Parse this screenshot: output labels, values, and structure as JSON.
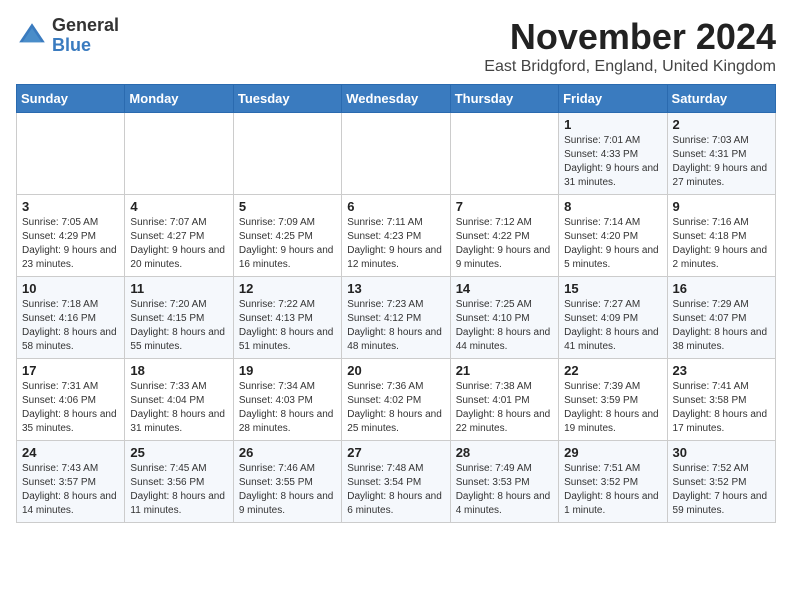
{
  "header": {
    "logo_general": "General",
    "logo_blue": "Blue",
    "month_title": "November 2024",
    "location": "East Bridgford, England, United Kingdom"
  },
  "days_of_week": [
    "Sunday",
    "Monday",
    "Tuesday",
    "Wednesday",
    "Thursday",
    "Friday",
    "Saturday"
  ],
  "weeks": [
    [
      {
        "day": "",
        "info": ""
      },
      {
        "day": "",
        "info": ""
      },
      {
        "day": "",
        "info": ""
      },
      {
        "day": "",
        "info": ""
      },
      {
        "day": "",
        "info": ""
      },
      {
        "day": "1",
        "info": "Sunrise: 7:01 AM\nSunset: 4:33 PM\nDaylight: 9 hours and 31 minutes."
      },
      {
        "day": "2",
        "info": "Sunrise: 7:03 AM\nSunset: 4:31 PM\nDaylight: 9 hours and 27 minutes."
      }
    ],
    [
      {
        "day": "3",
        "info": "Sunrise: 7:05 AM\nSunset: 4:29 PM\nDaylight: 9 hours and 23 minutes."
      },
      {
        "day": "4",
        "info": "Sunrise: 7:07 AM\nSunset: 4:27 PM\nDaylight: 9 hours and 20 minutes."
      },
      {
        "day": "5",
        "info": "Sunrise: 7:09 AM\nSunset: 4:25 PM\nDaylight: 9 hours and 16 minutes."
      },
      {
        "day": "6",
        "info": "Sunrise: 7:11 AM\nSunset: 4:23 PM\nDaylight: 9 hours and 12 minutes."
      },
      {
        "day": "7",
        "info": "Sunrise: 7:12 AM\nSunset: 4:22 PM\nDaylight: 9 hours and 9 minutes."
      },
      {
        "day": "8",
        "info": "Sunrise: 7:14 AM\nSunset: 4:20 PM\nDaylight: 9 hours and 5 minutes."
      },
      {
        "day": "9",
        "info": "Sunrise: 7:16 AM\nSunset: 4:18 PM\nDaylight: 9 hours and 2 minutes."
      }
    ],
    [
      {
        "day": "10",
        "info": "Sunrise: 7:18 AM\nSunset: 4:16 PM\nDaylight: 8 hours and 58 minutes."
      },
      {
        "day": "11",
        "info": "Sunrise: 7:20 AM\nSunset: 4:15 PM\nDaylight: 8 hours and 55 minutes."
      },
      {
        "day": "12",
        "info": "Sunrise: 7:22 AM\nSunset: 4:13 PM\nDaylight: 8 hours and 51 minutes."
      },
      {
        "day": "13",
        "info": "Sunrise: 7:23 AM\nSunset: 4:12 PM\nDaylight: 8 hours and 48 minutes."
      },
      {
        "day": "14",
        "info": "Sunrise: 7:25 AM\nSunset: 4:10 PM\nDaylight: 8 hours and 44 minutes."
      },
      {
        "day": "15",
        "info": "Sunrise: 7:27 AM\nSunset: 4:09 PM\nDaylight: 8 hours and 41 minutes."
      },
      {
        "day": "16",
        "info": "Sunrise: 7:29 AM\nSunset: 4:07 PM\nDaylight: 8 hours and 38 minutes."
      }
    ],
    [
      {
        "day": "17",
        "info": "Sunrise: 7:31 AM\nSunset: 4:06 PM\nDaylight: 8 hours and 35 minutes."
      },
      {
        "day": "18",
        "info": "Sunrise: 7:33 AM\nSunset: 4:04 PM\nDaylight: 8 hours and 31 minutes."
      },
      {
        "day": "19",
        "info": "Sunrise: 7:34 AM\nSunset: 4:03 PM\nDaylight: 8 hours and 28 minutes."
      },
      {
        "day": "20",
        "info": "Sunrise: 7:36 AM\nSunset: 4:02 PM\nDaylight: 8 hours and 25 minutes."
      },
      {
        "day": "21",
        "info": "Sunrise: 7:38 AM\nSunset: 4:01 PM\nDaylight: 8 hours and 22 minutes."
      },
      {
        "day": "22",
        "info": "Sunrise: 7:39 AM\nSunset: 3:59 PM\nDaylight: 8 hours and 19 minutes."
      },
      {
        "day": "23",
        "info": "Sunrise: 7:41 AM\nSunset: 3:58 PM\nDaylight: 8 hours and 17 minutes."
      }
    ],
    [
      {
        "day": "24",
        "info": "Sunrise: 7:43 AM\nSunset: 3:57 PM\nDaylight: 8 hours and 14 minutes."
      },
      {
        "day": "25",
        "info": "Sunrise: 7:45 AM\nSunset: 3:56 PM\nDaylight: 8 hours and 11 minutes."
      },
      {
        "day": "26",
        "info": "Sunrise: 7:46 AM\nSunset: 3:55 PM\nDaylight: 8 hours and 9 minutes."
      },
      {
        "day": "27",
        "info": "Sunrise: 7:48 AM\nSunset: 3:54 PM\nDaylight: 8 hours and 6 minutes."
      },
      {
        "day": "28",
        "info": "Sunrise: 7:49 AM\nSunset: 3:53 PM\nDaylight: 8 hours and 4 minutes."
      },
      {
        "day": "29",
        "info": "Sunrise: 7:51 AM\nSunset: 3:52 PM\nDaylight: 8 hours and 1 minute."
      },
      {
        "day": "30",
        "info": "Sunrise: 7:52 AM\nSunset: 3:52 PM\nDaylight: 7 hours and 59 minutes."
      }
    ]
  ]
}
